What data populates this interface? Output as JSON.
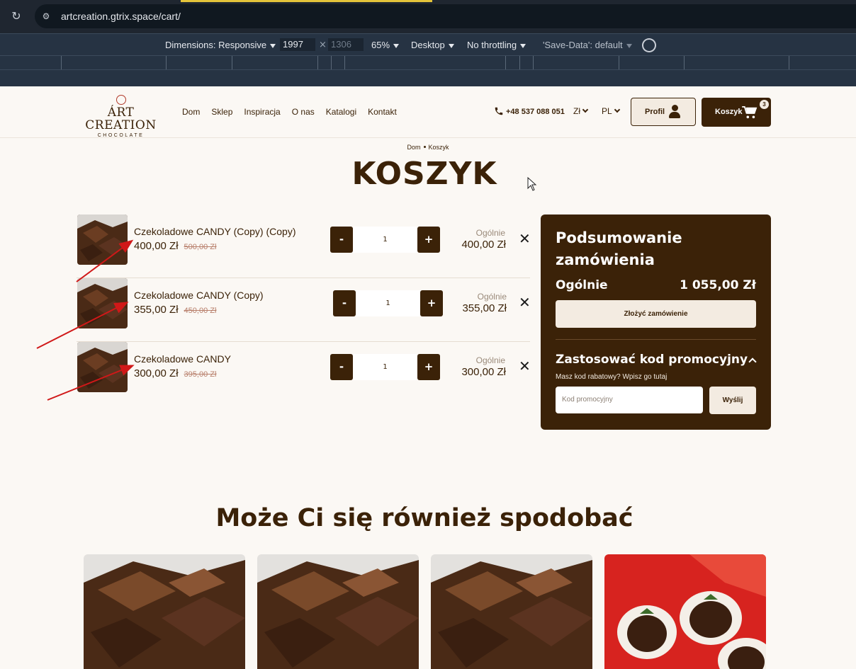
{
  "browser": {
    "url": "artcreation.gtrix.space/cart/",
    "devtools": {
      "dimensions_label": "Dimensions: Responsive",
      "width": "1997",
      "height": "1306",
      "zoom": "65%",
      "device": "Desktop",
      "throttling": "No throttling",
      "save_data": "'Save-Data': default"
    }
  },
  "header": {
    "logo_main": "ÁRT CREATION",
    "logo_sub": "CHOCOLATE",
    "nav": [
      "Dom",
      "Sklep",
      "Inspiracja",
      "O nas",
      "Katalogi",
      "Kontakt"
    ],
    "phone": "+48 537 088 051",
    "currency": "Zł",
    "language": "PL",
    "profile_label": "Profil",
    "cart_label": "Koszyk",
    "cart_count": "3"
  },
  "breadcrumb": {
    "home": "Dom",
    "current": "Koszyk"
  },
  "page_title": "KOSZYK",
  "cart": {
    "items": [
      {
        "name": "Czekoladowe CANDY (Copy) (Copy)",
        "price": "400,00 Zł",
        "old_price": "500,00 Zł",
        "qty": "1",
        "total_label": "Ogólnie",
        "total": "400,00 Zł"
      },
      {
        "name": "Czekoladowe CANDY (Copy)",
        "price": "355,00 Zł",
        "old_price": "450,00 Zł",
        "qty": "1",
        "total_label": "Ogólnie",
        "total": "355,00 Zł"
      },
      {
        "name": "Czekoladowe CANDY",
        "price": "300,00 Zł",
        "old_price": "395,00 Zł",
        "qty": "1",
        "total_label": "Ogólnie",
        "total": "300,00 Zł"
      }
    ],
    "minus": "-",
    "plus": "+",
    "remove": "✕"
  },
  "summary": {
    "title": "Podsumowanie zamówienia",
    "total_label": "Ogólnie",
    "total_value": "1 055,00 Zł",
    "order_button": "Złożyć zamówienie",
    "promo_title": "Zastosować kod promocyjny",
    "promo_hint": "Masz kod rabatowy? Wpisz go tutaj",
    "promo_placeholder": "Kod promocyjny",
    "promo_send": "Wyślij"
  },
  "related": {
    "title": "Może Ci się również spodobać"
  },
  "colors": {
    "brand": "#3b2208",
    "cream": "#f3ebe1",
    "background": "#fbf8f4",
    "annotation": "#d01818"
  }
}
